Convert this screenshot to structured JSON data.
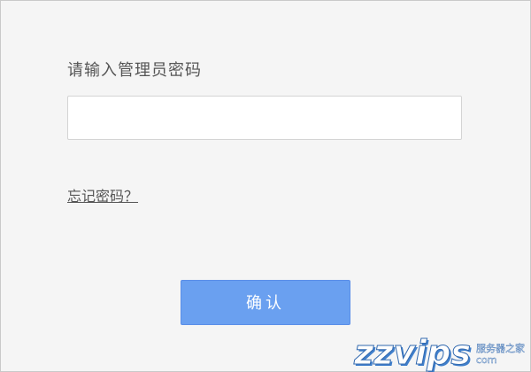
{
  "dialog": {
    "prompt": "请输入管理员密码",
    "password_value": "",
    "forgot_label": "忘记密码？",
    "confirm_label": "确认"
  },
  "watermark": {
    "logo": "zzvips",
    "sub_top": "服务器之家",
    "sub_bottom": "com"
  }
}
